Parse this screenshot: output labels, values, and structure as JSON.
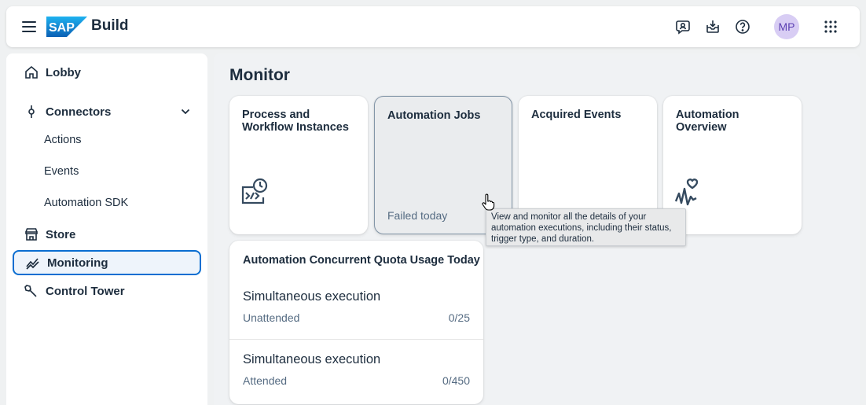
{
  "header": {
    "brand_logo": "SAP",
    "brand_name": "Build",
    "avatar_initials": "MP",
    "icons": [
      "hamburger-menu-icon",
      "sap-logo",
      "feedback-icon",
      "inbox-icon",
      "help-icon",
      "avatar",
      "app-grid-icon"
    ]
  },
  "sidebar": {
    "items": [
      {
        "label": "Lobby",
        "icon": "home-icon"
      },
      {
        "label": "Connectors",
        "icon": "connector-icon"
      },
      {
        "label": "Actions"
      },
      {
        "label": "Events"
      },
      {
        "label": "Automation SDK"
      },
      {
        "label": "Store",
        "icon": "store-icon"
      },
      {
        "label": "Monitoring",
        "icon": "monitoring-icon",
        "active": true
      },
      {
        "label": "Control Tower",
        "icon": "wrench-icon"
      }
    ]
  },
  "main": {
    "title": "Monitor",
    "cards": [
      {
        "title": "Process and Workflow Instances",
        "icon": "process-monitor-icon"
      },
      {
        "title": "Automation Jobs",
        "footer": "Failed today"
      },
      {
        "title": "Acquired Events"
      },
      {
        "title": "Automation Overview",
        "icon": "health-icon"
      }
    ],
    "quota": {
      "title": "Automation Concurrent Quota Usage Today",
      "rows": [
        {
          "title": "Simultaneous execution",
          "label": "Unattended",
          "value": "0/25"
        },
        {
          "title": "Simultaneous execution",
          "label": "Attended",
          "value": "0/450"
        }
      ]
    },
    "tooltip": "View and monitor all the details of your automation executions, including their status, trigger type, and duration."
  },
  "colors": {
    "accent": "#0a6ed1",
    "avatar_bg": "#d8cdf4",
    "text": "#1d2d3e",
    "muted": "#556b82"
  }
}
